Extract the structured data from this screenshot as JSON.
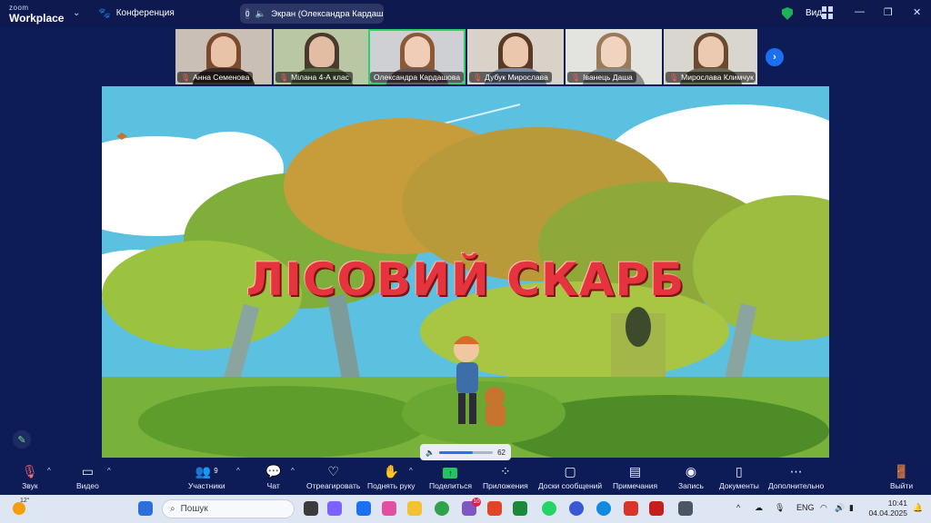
{
  "app": {
    "brand_top": "zoom",
    "brand_bottom": "Workplace",
    "meeting_title": "Конференция",
    "view_label": "Вид"
  },
  "share": {
    "badge": "0",
    "label": "Экран (Олександра Кардашова)"
  },
  "participants": [
    {
      "name": "Анна Семенова",
      "muted": true
    },
    {
      "name": "Мілана 4-А клас",
      "muted": true
    },
    {
      "name": "Олександра Кардашова",
      "muted": false,
      "active": true
    },
    {
      "name": "Дубук Мирослава",
      "muted": true
    },
    {
      "name": "Іванець Даша",
      "muted": true
    },
    {
      "name": "Мирослава Климчук",
      "muted": true
    }
  ],
  "scene": {
    "title": "ЛІСОВИЙ СКАРБ"
  },
  "volume": {
    "value": "62",
    "level": 0.62
  },
  "toolbar": {
    "audio": "Звук",
    "video": "Видео",
    "participants": "Участники",
    "participants_count": "9",
    "chat": "Чат",
    "react": "Отреагировать",
    "raise_hand": "Поднять руку",
    "share": "Поделиться",
    "apps": "Приложения",
    "whiteboards": "Доски сообщений",
    "notes": "Примечания",
    "record": "Запись",
    "docs": "Документы",
    "more": "Дополнительно",
    "leave": "Выйти"
  },
  "taskbar": {
    "temp": "12°",
    "search_placeholder": "Пошук",
    "viber_badge": "10",
    "lang": "ENG",
    "time": "10:41",
    "date": "04.04.2025"
  },
  "colors": {
    "accent": "#1c6ff0",
    "active_border": "#2fd06b",
    "title_red": "#e5343d"
  }
}
